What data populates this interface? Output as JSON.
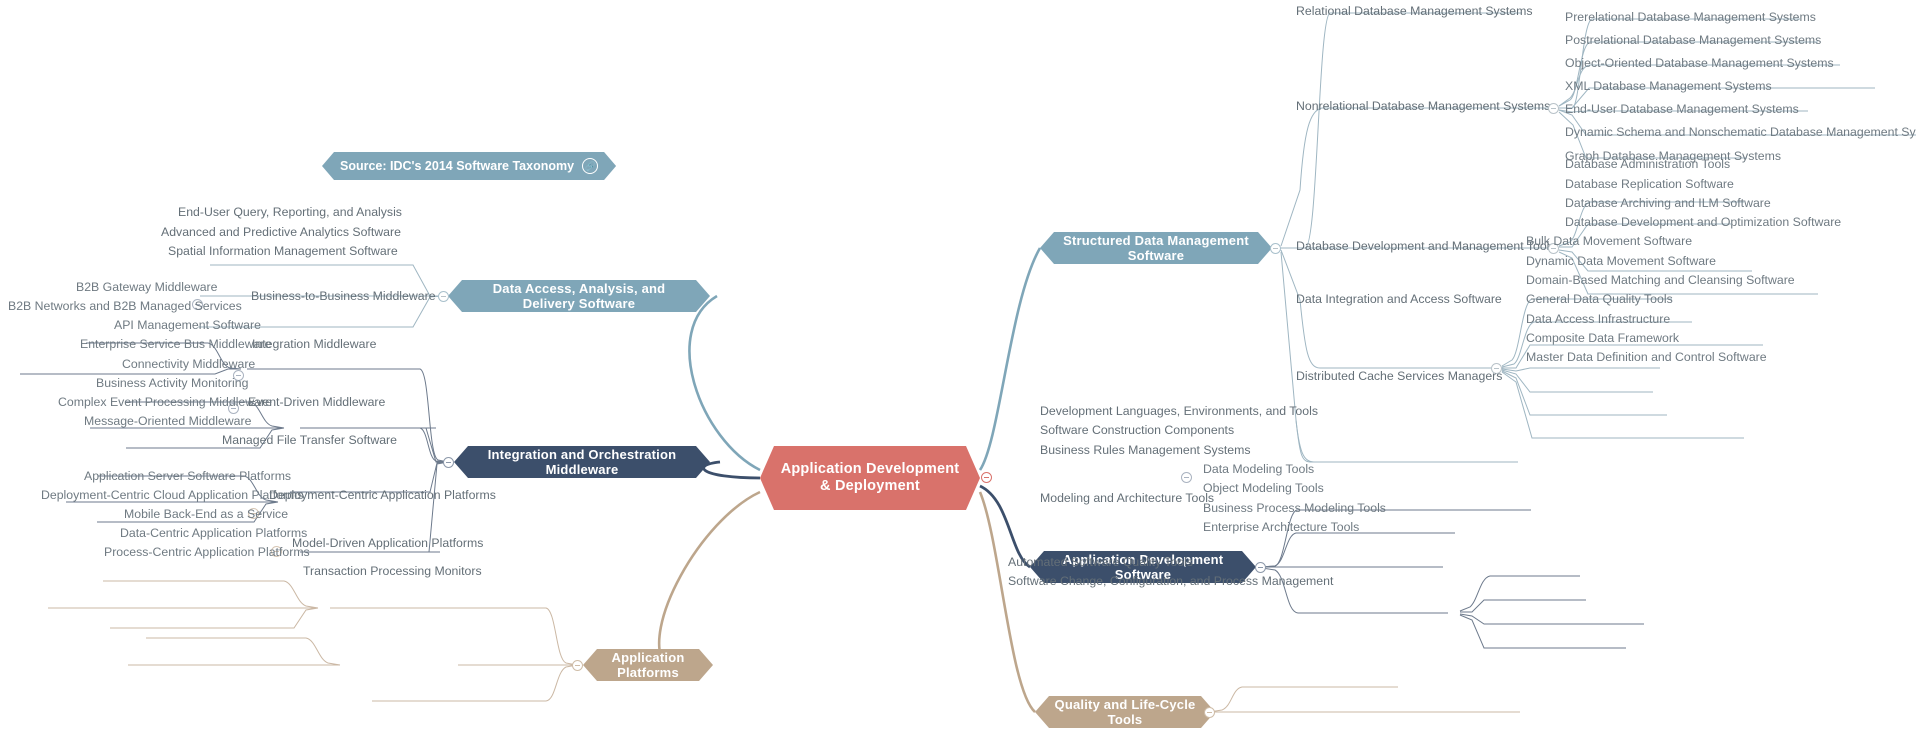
{
  "source_badge": {
    "label": "Source: IDC's 2014 Software Taxonomy",
    "icon": "link-icon",
    "color": "#7fa6b8"
  },
  "root": {
    "label": "Application Development & Deployment",
    "color": "#d9726b"
  },
  "colors": {
    "structured_data": "#7fa6b8",
    "data_access": "#7fa6b8",
    "integration": "#3c4f6b",
    "app_dev": "#3c4f6b",
    "app_platforms": "#bda68c",
    "quality": "#bda68c"
  },
  "branches": [
    {
      "id": "structured-data-management-software",
      "label": "Structured Data Management Software",
      "side": "right",
      "color": "#7fa6b8",
      "children": [
        {
          "label": "Relational Database Management Systems",
          "children": []
        },
        {
          "label": "Nonrelational Database Management Systems",
          "children": [
            "Prerelational Database Management Systems",
            "Postrelational Database Management Systems",
            "Object-Oriented Database Management Systems",
            "XML Database Management Systems",
            "End-User Database Management Systems",
            "Dynamic Schema and Nonschematic Database Management Systems",
            "Graph Database Management Systems"
          ]
        },
        {
          "label": "Database Development and Management Tools",
          "children": [
            "Database Administration Tools",
            "Database Replication Software",
            "Database Archiving and ILM Software",
            "Database Development and Optimization Software"
          ]
        },
        {
          "label": "Data Integration and Access Software",
          "children": [
            "Bulk Data Movement Software",
            "Dynamic Data Movement Software",
            "Domain-Based Matching and Cleansing Software",
            "General Data Quality Tools",
            "Data Access Infrastructure",
            "Composite Data Framework",
            "Master Data Definition and Control Software"
          ]
        },
        {
          "label": "Distributed Cache Services Managers",
          "children": []
        }
      ]
    },
    {
      "id": "data-access-analysis-and-delivery-software",
      "label": "Data Access, Analysis, and Delivery Software",
      "side": "left",
      "color": "#7fa6b8",
      "children": [
        {
          "label": "End-User Query, Reporting, and Analysis",
          "children": []
        },
        {
          "label": "Advanced and Predictive Analytics Software",
          "children": []
        },
        {
          "label": "Spatial Information Management Software",
          "children": []
        }
      ]
    },
    {
      "id": "integration-and-orchestration-middleware",
      "label": "Integration and Orchestration Middleware",
      "side": "left",
      "color": "#3c4f6b",
      "children": [
        {
          "label": "Business-to-Business Middleware",
          "children": [
            "B2B Gateway Middleware",
            "B2B Networks and B2B Managed Services"
          ]
        },
        {
          "label": "Integration Middleware",
          "children": [
            "API Management Software",
            "Enterprise Service Bus Middleware",
            "Connectivity Middleware"
          ]
        },
        {
          "label": "Event-Driven Middleware",
          "children": [
            "Business Activity Monitoring",
            "Complex Event Processing Middleware",
            "Message-Oriented Middleware"
          ]
        },
        {
          "label": "Managed File Transfer Software",
          "children": []
        }
      ]
    },
    {
      "id": "application-development-software",
      "label": "Application Development Software",
      "side": "right",
      "color": "#3c4f6b",
      "children": [
        {
          "label": "Development Languages, Environments, and Tools",
          "children": []
        },
        {
          "label": "Software Construction Components",
          "children": []
        },
        {
          "label": "Business Rules Management Systems",
          "children": []
        },
        {
          "label": "Modeling and Architecture Tools",
          "children": [
            "Data Modeling Tools",
            "Object Modeling Tools",
            "Business Process Modeling Tools",
            "Enterprise Architecture Tools"
          ]
        }
      ]
    },
    {
      "id": "application-platforms",
      "label": "Application Platforms",
      "side": "left",
      "color": "#bda68c",
      "children": [
        {
          "label": "Deployment-Centric Application Platforms",
          "children": [
            "Application Server Software Platforms",
            "Deployment-Centric Cloud Application Platforms",
            "Mobile Back-End as a Service"
          ]
        },
        {
          "label": "Model-Driven Application Platforms",
          "children": [
            "Data-Centric Application Platforms",
            "Process-Centric Application Platforms"
          ]
        },
        {
          "label": "Transaction Processing Monitors",
          "children": []
        }
      ]
    },
    {
      "id": "quality-and-life-cycle-tools",
      "label": "Quality and Life-Cycle Tools",
      "side": "right",
      "color": "#bda68c",
      "children": [
        {
          "label": "Automated Software Quality Tools",
          "children": []
        },
        {
          "label": "Software Change, Configuration, and Process Management",
          "children": []
        }
      ]
    }
  ]
}
